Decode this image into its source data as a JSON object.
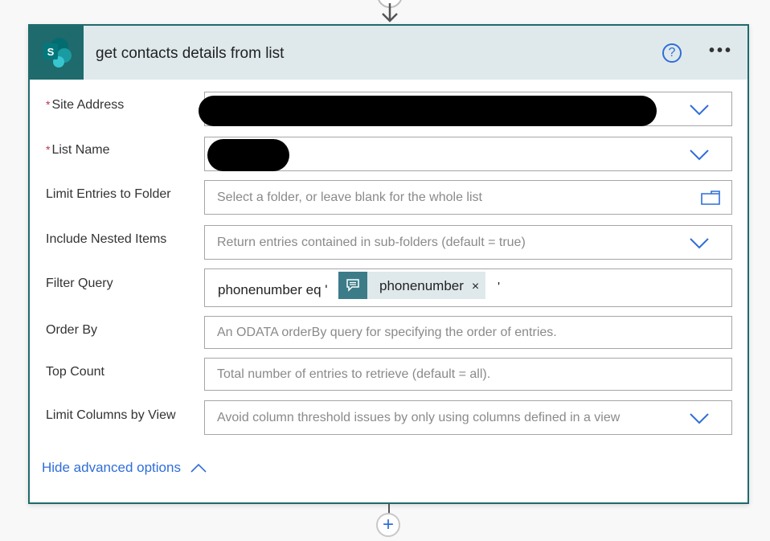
{
  "card": {
    "title": "get contacts details from list",
    "connector_icon": "sharepoint-logo",
    "logo_letter": "S",
    "help_label": "?",
    "more_label": "•••"
  },
  "fields": [
    {
      "label": "Site Address",
      "required": true,
      "value": "[redacted]",
      "control": "dropdown"
    },
    {
      "label": "List Name",
      "required": true,
      "value": "[redacted]",
      "control": "dropdown"
    },
    {
      "label": "Limit Entries to Folder",
      "required": false,
      "placeholder": "Select a folder, or leave blank for the whole list",
      "control": "folder-picker"
    },
    {
      "label": "Include Nested Items",
      "required": false,
      "placeholder": "Return entries contained in sub-folders (default = true)",
      "control": "dropdown"
    },
    {
      "label": "Filter Query",
      "required": false,
      "control": "expression",
      "value_prefix": "phonenumber eq '",
      "token": "phonenumber",
      "token_remove": "×",
      "value_suffix": "'"
    },
    {
      "label": "Order By",
      "required": false,
      "placeholder": "An ODATA orderBy query for specifying the order of entries.",
      "control": "text"
    },
    {
      "label": "Top Count",
      "required": false,
      "placeholder": "Total number of entries to retrieve (default = all).",
      "control": "text"
    },
    {
      "label": "Limit Columns by View",
      "required": false,
      "placeholder": "Avoid column threshold issues by only using columns defined in a view",
      "control": "dropdown"
    }
  ],
  "required_marker": "*",
  "advanced_toggle": "Hide advanced options",
  "add_step_label": "+",
  "colors": {
    "accent": "#1f6a6c",
    "header_bg": "#dfe9ec",
    "link": "#2f6ed8",
    "required": "#c4314b",
    "token": "#3c7c88"
  }
}
